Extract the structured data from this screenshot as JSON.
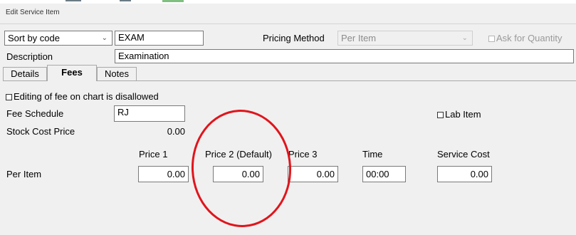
{
  "window": {
    "title": "Edit Service Item"
  },
  "header": {
    "sort_select": "Sort by code",
    "code_value": "EXAM",
    "pricing_method_label": "Pricing Method",
    "pricing_method_value": "Per Item",
    "ask_quantity_label": "Ask for Quantity",
    "description_label": "Description",
    "description_value": "Examination"
  },
  "tabs": [
    {
      "label": "Details",
      "active": false
    },
    {
      "label": "Fees",
      "active": true
    },
    {
      "label": "Notes",
      "active": false
    }
  ],
  "fees": {
    "editing_disallowed_label": "Editing of fee on chart is disallowed",
    "fee_schedule_label": "Fee Schedule",
    "fee_schedule_value": "RJ",
    "lab_item_label": "Lab Item",
    "stock_cost_label": "Stock Cost Price",
    "stock_cost_value": "0.00",
    "columns": {
      "price1": "Price 1",
      "price2": "Price 2 (Default)",
      "price3": "Price 3",
      "time": "Time",
      "service_cost": "Service Cost"
    },
    "row_label": "Per Item",
    "values": {
      "price1": "0.00",
      "price2": "0.00",
      "price3": "0.00",
      "time": "00:00",
      "service_cost": "0.00"
    }
  },
  "colors": {
    "annotation": "#e0151c",
    "background": "#f0f0f0"
  },
  "icons": {
    "dropdown": "chevron-down-icon",
    "checkbox": "checkbox-icon"
  }
}
